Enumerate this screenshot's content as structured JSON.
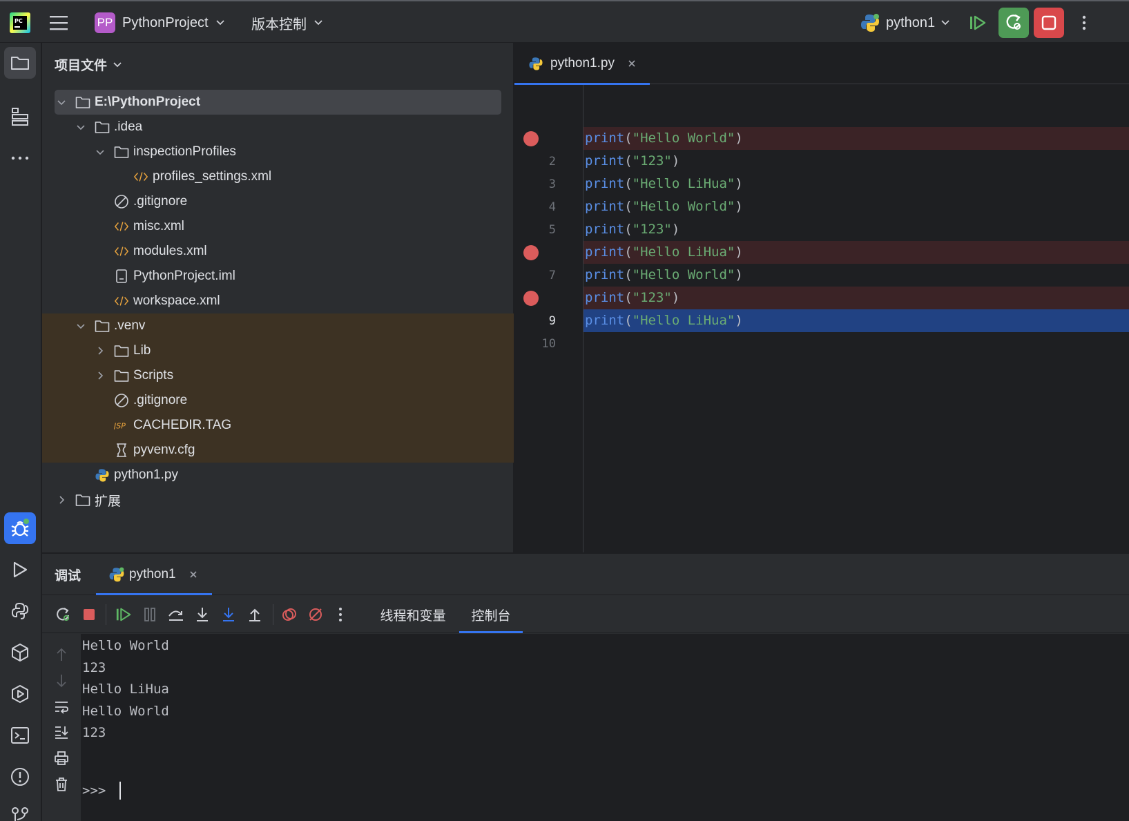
{
  "titlebar": {
    "project_badge": "PP",
    "project_name": "PythonProject",
    "vcs_label": "版本控制",
    "run_config": "python1"
  },
  "project_panel": {
    "header": "项目文件",
    "tree": [
      {
        "label": "E:\\PythonProject",
        "type": "folder",
        "expanded": true
      },
      {
        "label": ".idea",
        "type": "folder",
        "expanded": true
      },
      {
        "label": "inspectionProfiles",
        "type": "folder",
        "expanded": true
      },
      {
        "label": "profiles_settings.xml",
        "type": "xml"
      },
      {
        "label": ".gitignore",
        "type": "ignore"
      },
      {
        "label": "misc.xml",
        "type": "xml"
      },
      {
        "label": "modules.xml",
        "type": "xml"
      },
      {
        "label": "PythonProject.iml",
        "type": "iml"
      },
      {
        "label": "workspace.xml",
        "type": "xml"
      },
      {
        "label": ".venv",
        "type": "folder",
        "expanded": true
      },
      {
        "label": "Lib",
        "type": "folder",
        "expanded": false
      },
      {
        "label": "Scripts",
        "type": "folder",
        "expanded": false
      },
      {
        "label": ".gitignore",
        "type": "ignore"
      },
      {
        "label": "CACHEDIR.TAG",
        "type": "tag"
      },
      {
        "label": "pyvenv.cfg",
        "type": "cfg"
      },
      {
        "label": "python1.py",
        "type": "python"
      },
      {
        "label": "扩展",
        "type": "folder",
        "expanded": false
      }
    ]
  },
  "editor": {
    "tab_label": "python1.py",
    "lines": [
      {
        "num": "",
        "fn": "print",
        "open": "(",
        "arg": "\"Hello World\"",
        "close": ")",
        "breakpoint": true
      },
      {
        "num": "2",
        "fn": "print",
        "open": "(",
        "arg": "\"123\"",
        "close": ")",
        "breakpoint": false
      },
      {
        "num": "3",
        "fn": "print",
        "open": "(",
        "arg": "\"Hello LiHua\"",
        "close": ")",
        "breakpoint": false
      },
      {
        "num": "4",
        "fn": "print",
        "open": "(",
        "arg": "\"Hello World\"",
        "close": ")",
        "breakpoint": false
      },
      {
        "num": "5",
        "fn": "print",
        "open": "(",
        "arg": "\"123\"",
        "close": ")",
        "breakpoint": false
      },
      {
        "num": "",
        "fn": "print",
        "open": "(",
        "arg": "\"Hello LiHua\"",
        "close": ")",
        "breakpoint": true
      },
      {
        "num": "7",
        "fn": "print",
        "open": "(",
        "arg": "\"Hello World\"",
        "close": ")",
        "breakpoint": false
      },
      {
        "num": "",
        "fn": "print",
        "open": "(",
        "arg": "\"123\"",
        "close": ")",
        "breakpoint": true
      },
      {
        "num": "9",
        "fn": "print",
        "open": "(",
        "arg": "\"Hello LiHua\"",
        "close": ")",
        "breakpoint": false,
        "current": true
      },
      {
        "num": "10",
        "fn": "",
        "open": "",
        "arg": "",
        "close": "",
        "breakpoint": false
      }
    ]
  },
  "debug": {
    "title": "调试",
    "session_tab": "python1",
    "tab_threads": "线程和变量",
    "tab_console": "控制台",
    "console_lines": [
      "Hello World",
      "123",
      "Hello LiHua",
      "Hello World",
      "123"
    ],
    "prompt": ">>>"
  },
  "colors": {
    "accent": "#3574f0",
    "breakpoint": "#db5c5c",
    "run_green": "#4e9a56",
    "stop_red": "#d9484b"
  }
}
